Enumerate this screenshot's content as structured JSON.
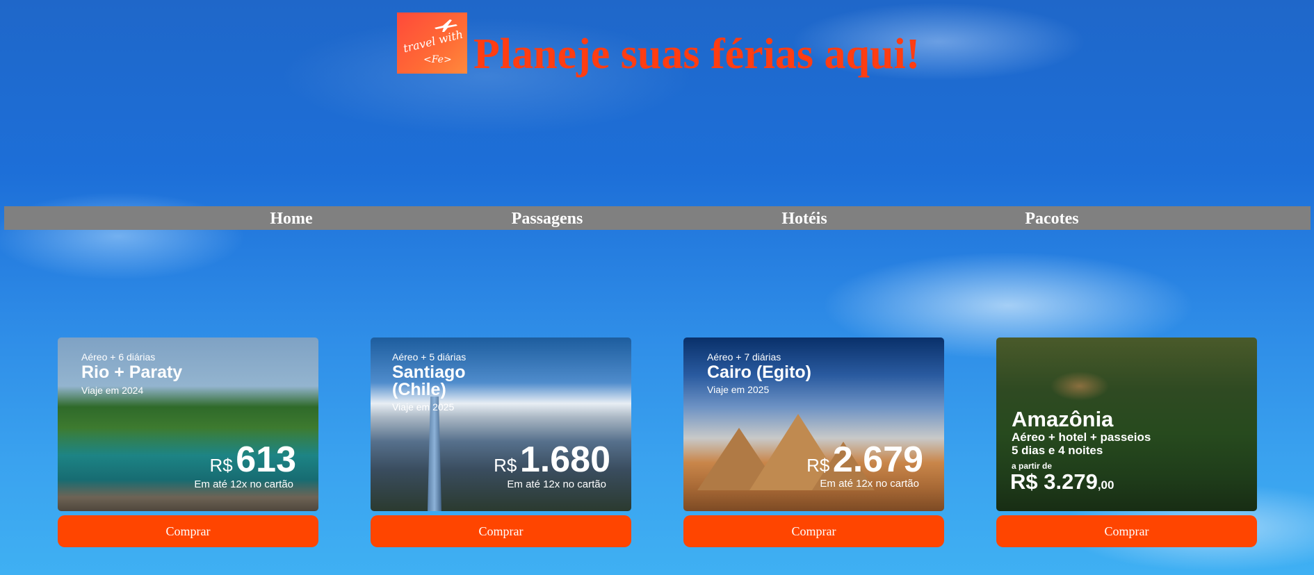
{
  "header": {
    "logo_line1": "travel with",
    "logo_line2": "<Fe>",
    "title": "Planeje suas férias aqui!"
  },
  "nav": [
    "Home",
    "Passagens",
    "Hotéis",
    "Pacotes"
  ],
  "cards": [
    {
      "tag": "Aéreo + 6 diárias",
      "destination": "Rio + Paraty",
      "year": "Viaje em 2024",
      "currency": "R$",
      "price": "613",
      "installments": "Em até 12x no cartão",
      "button": "Comprar"
    },
    {
      "tag": "Aéreo + 5 diárias",
      "destination_line1": "Santiago",
      "destination_line2": "(Chile)",
      "year": "Viaje em 2025",
      "currency": "R$",
      "price": "1.680",
      "installments": "Em até 12x no cartão",
      "button": "Comprar"
    },
    {
      "tag": "Aéreo + 7 diárias",
      "destination": "Cairo (Egito)",
      "year": "Viaje em 2025",
      "currency": "R$",
      "price": "2.679",
      "installments": "Em até 12x no cartão",
      "button": "Comprar"
    },
    {
      "destination": "Amazônia",
      "line1": "Aéreo + hotel + passeios",
      "line2": "5 dias e 4 noites",
      "from": "a partir de",
      "price": "R$ 3.279",
      "cents": ",00",
      "button": "Comprar"
    }
  ],
  "colors": {
    "accent": "#ff4500",
    "title": "#ff3d12",
    "nav_bg": "#808080"
  }
}
